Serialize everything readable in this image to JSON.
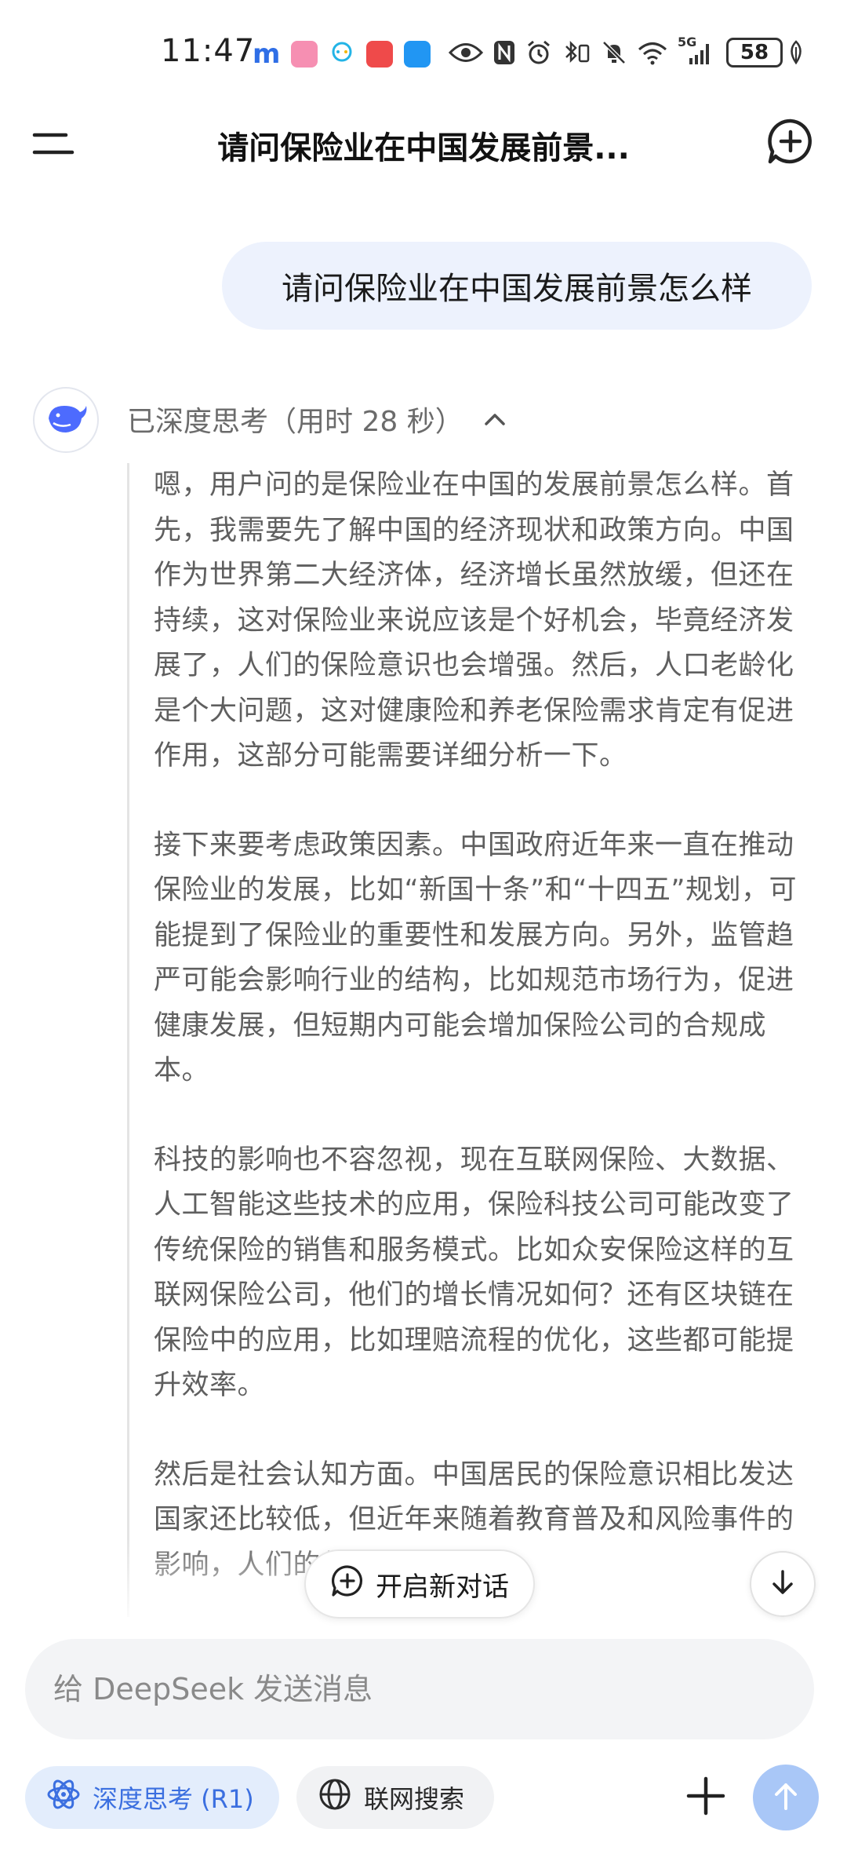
{
  "status_bar": {
    "time": "11:47",
    "network": "5G",
    "battery": "58",
    "app_icons": [
      "m-app-icon",
      "bilibili-icon",
      "chat-bubble-app-icon",
      "huawei-app-icon",
      "message-app-icon"
    ],
    "system_icons": [
      "eye-icon",
      "nfc-icon",
      "alarm-icon",
      "bluetooth-icon",
      "mute-icon",
      "wifi-icon",
      "signal-icon",
      "leaf-icon"
    ]
  },
  "header": {
    "title": "请问保险业在中国发展前景..."
  },
  "conversation": {
    "user_message": "请问保险业在中国发展前景怎么样",
    "thinking_label": "已深度思考（用时 28 秒）",
    "thinking_paragraphs": [
      "嗯，用户问的是保险业在中国的发展前景怎么样。首先，我需要先了解中国的经济现状和政策方向。中国作为世界第二大经济体，经济增长虽然放缓，但还在持续，这对保险业来说应该是个好机会，毕竟经济发展了，人们的保险意识也会增强。然后，人口老龄化是个大问题，这对健康险和养老保险需求肯定有促进作用，这部分可能需要详细分析一下。",
      "接下来要考虑政策因素。中国政府近年来一直在推动保险业的发展，比如“新国十条”和“十四五”规划，可能提到了保险业的重要性和发展方向。另外，监管趋严可能会影响行业的结构，比如规范市场行为，促进健康发展，但短期内可能会增加保险公司的合规成本。",
      "科技的影响也不容忽视，现在互联网保险、大数据、人工智能这些技术的应用，保险科技公司可能改变了传统保险的销售和服务模式。比如众安保险这样的互联网保险公司，他们的增长情况如何？还有区块链在保险中的应用，比如理赔流程的优化，这些都可能提升效率。",
      "然后是社会认知方面。中国居民的保险意识相比发达国家还比较低，但近年来随着教育普及和风险事件的影响，人们的保险意识"
    ]
  },
  "floating": {
    "new_chat_label": "开启新对话"
  },
  "composer": {
    "placeholder": "给 DeepSeek 发送消息"
  },
  "toolbar": {
    "deep_think_label": "深度思考 (R1)",
    "web_search_label": "联网搜索"
  },
  "colors": {
    "accent": "#3b6fe0",
    "user_bubble": "#edf2fd",
    "send_button": "#a9c7f7"
  }
}
